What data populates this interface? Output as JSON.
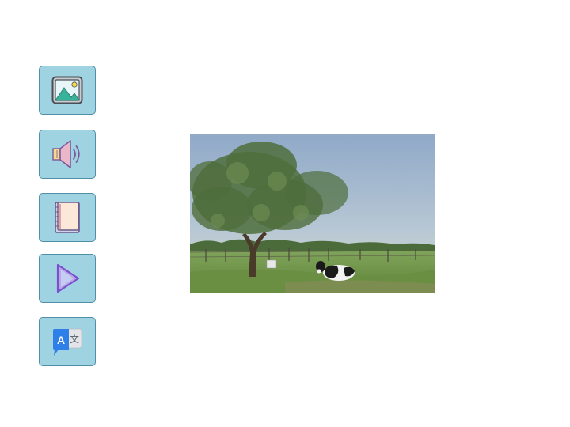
{
  "toolbar": {
    "buttons": [
      {
        "id": "image",
        "icon": "image-icon"
      },
      {
        "id": "audio",
        "icon": "speaker-icon"
      },
      {
        "id": "book",
        "icon": "notebook-icon"
      },
      {
        "id": "play",
        "icon": "play-icon"
      },
      {
        "id": "translate",
        "icon": "translate-icon"
      }
    ],
    "colors": {
      "button_fill": "#9fd3e2",
      "button_border": "#4f8fa8"
    }
  },
  "translate_icon": {
    "latin_glyph": "A",
    "cjk_glyph": "文"
  },
  "photo": {
    "subject": "tree-and-cow-in-pasture"
  }
}
